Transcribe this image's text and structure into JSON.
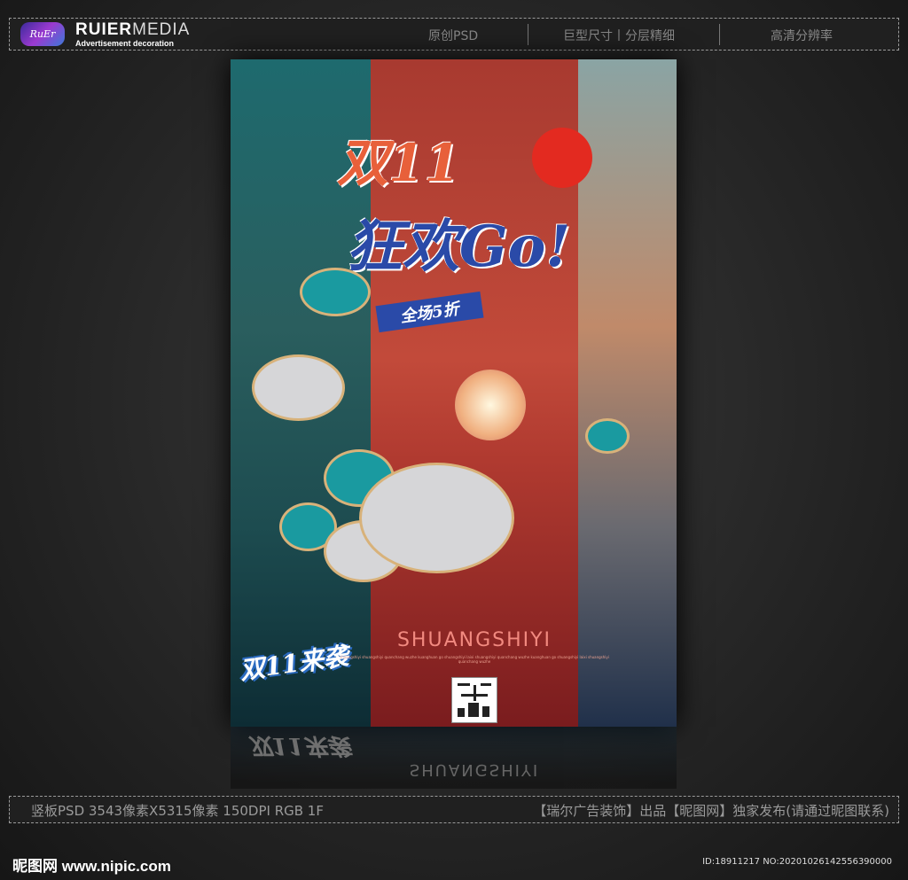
{
  "header": {
    "logo_text": "RuEr",
    "brand_bold": "RUIER",
    "brand_light": "MEDIA",
    "brand_sub": "Advertisement decoration",
    "items": [
      "原创PSD",
      "巨型尺寸丨分层精细",
      "高清分辨率"
    ]
  },
  "poster": {
    "title_line1": "双11",
    "title_line2": "狂欢Go!",
    "banner": "全场5折",
    "slogan": "双11来袭",
    "english": "SHUANGSHIYI",
    "small_text": "shuangshiyi shuangshiyi quanchang wuzhe kuanghuan go shuangshiyi laixi shuangshiyi quanchang wuzhe kuanghuan go shuangshiyi laixi shuangshiyi quanchang wuzhe",
    "colors": {
      "teal": "#1e6a6e",
      "red": "#c24a3a",
      "blue": "#2a4aa8"
    }
  },
  "footer": {
    "spec": "竖板PSD 3543像素X5315像素 150DPI RGB 1F",
    "credit": "【瑞尔广告装饰】出品【昵图网】独家发布(请通过昵图联系)",
    "site": "昵图网 www.nipic.com",
    "id": "ID:18911217 NO:20201026142556390000"
  }
}
